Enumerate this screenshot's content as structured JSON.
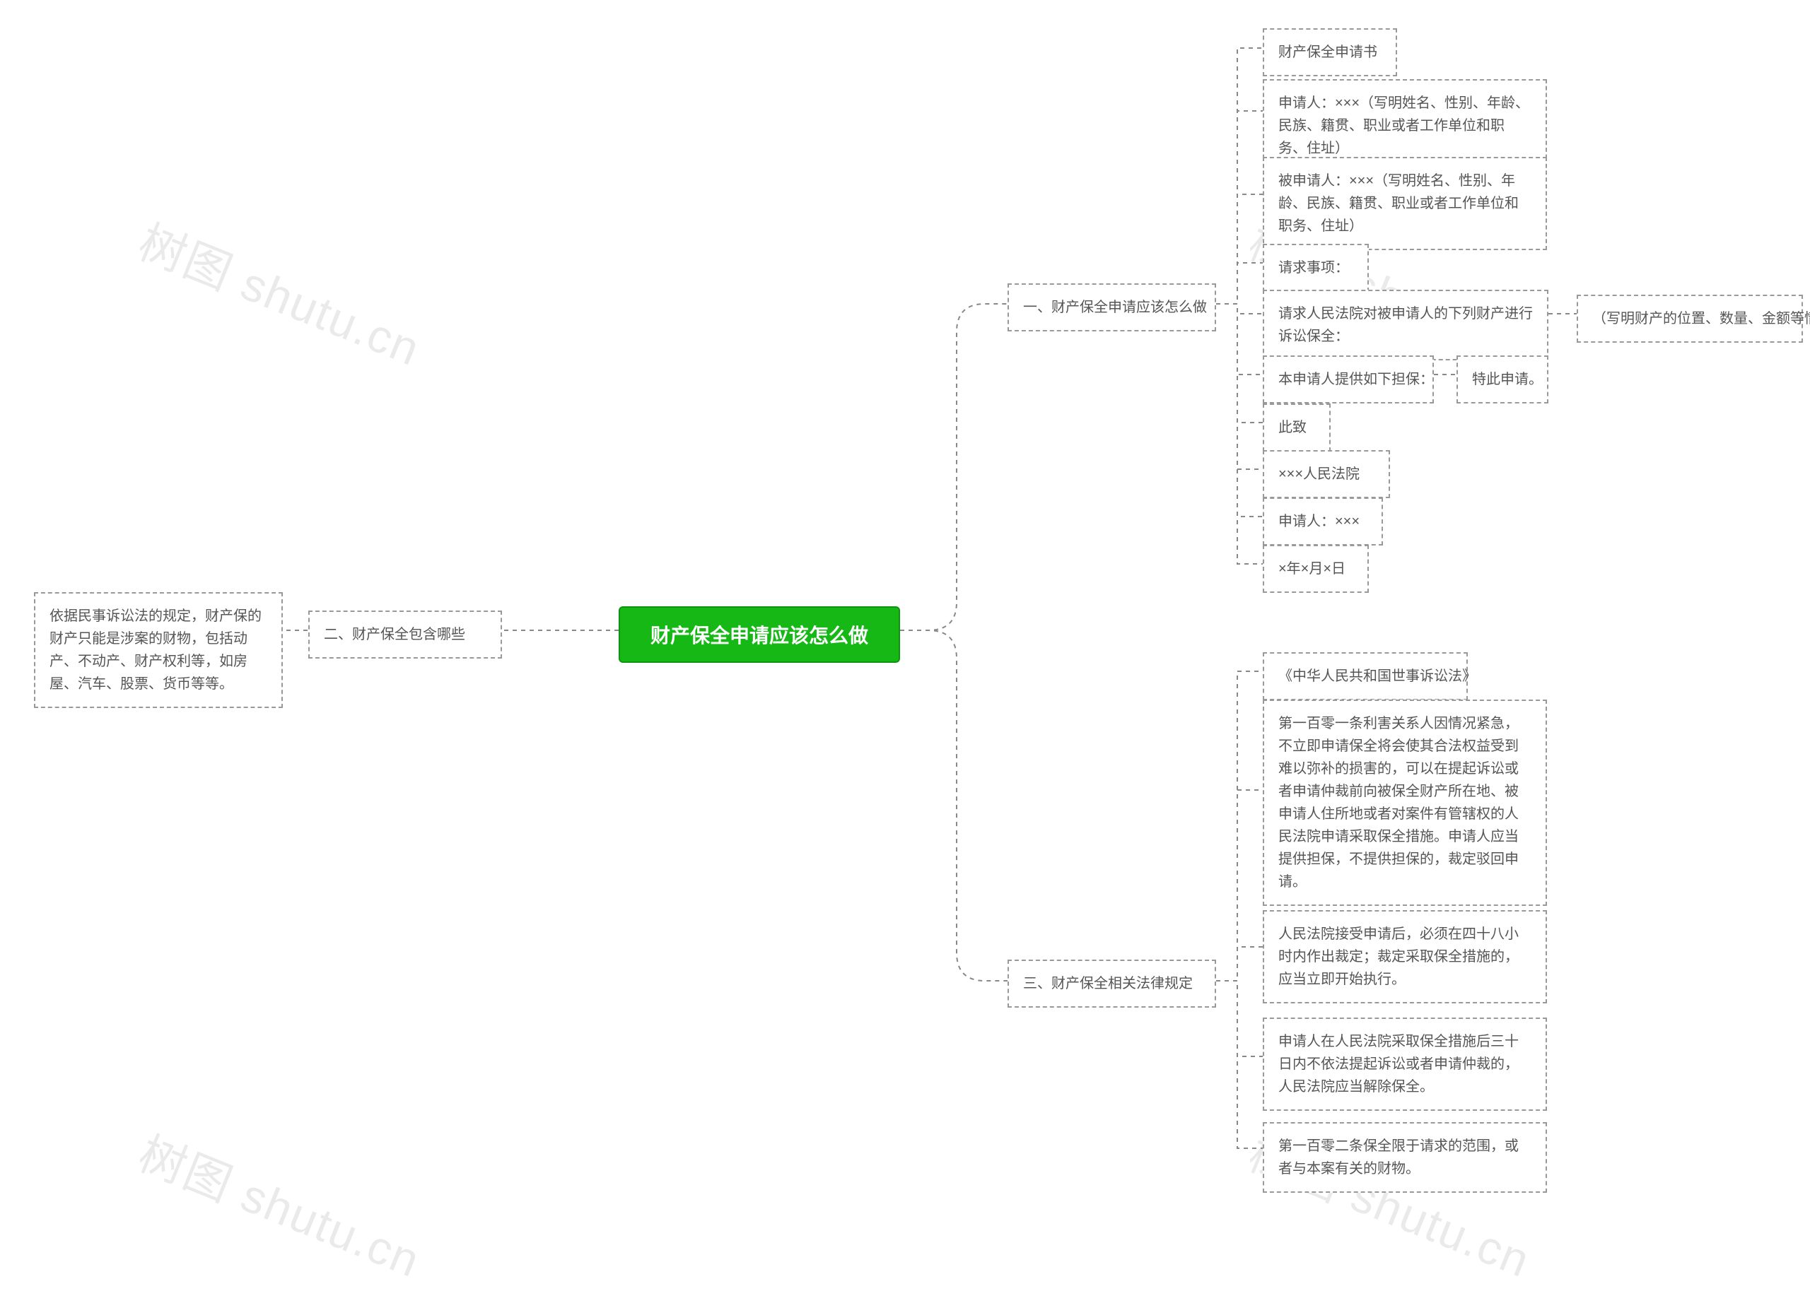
{
  "watermarks": [
    "树图 shutu.cn",
    "树图 shutu.cn",
    "树图 shutu.cn",
    "树图 shutu.cn"
  ],
  "root": {
    "title": "财产保全申请应该怎么做"
  },
  "branch1": {
    "label": "一、财产保全申请应该怎么做",
    "items": [
      "财产保全申请书",
      "申请人：×××（写明姓名、性别、年龄、民族、籍贯、职业或者工作单位和职务、住址）",
      "被申请人：×××（写明姓名、性别、年龄、民族、籍贯、职业或者工作单位和职务、住址）",
      "请求事项：",
      "请求人民法院对被申请人的下列财产进行诉讼保全：",
      "本申请人提供如下担保：",
      "此致",
      "×××人民法院",
      "申请人：×××",
      "×年×月×日"
    ],
    "item4_extra": "（写明财产的位置、数量、金额等情况）",
    "item5_extra": "特此申请。"
  },
  "branch2": {
    "label": "二、财产保全包含哪些",
    "detail": "依据民事诉讼法的规定，财产保的财产只能是涉案的财物，包括动产、不动产、财产权利等，如房屋、汽车、股票、货币等等。"
  },
  "branch3": {
    "label": "三、财产保全相关法律规定",
    "items": [
      "《中华人民共和国世事诉讼法》",
      "第一百零一条利害关系人因情况紧急，不立即申请保全将会使其合法权益受到难以弥补的损害的，可以在提起诉讼或者申请仲裁前向被保全财产所在地、被申请人住所地或者对案件有管辖权的人民法院申请采取保全措施。申请人应当提供担保，不提供担保的，裁定驳回申请。",
      "人民法院接受申请后，必须在四十八小时内作出裁定；裁定采取保全措施的，应当立即开始执行。",
      "申请人在人民法院采取保全措施后三十日内不依法提起诉讼或者申请仲裁的，人民法院应当解除保全。",
      "第一百零二条保全限于请求的范围，或者与本案有关的财物。"
    ]
  }
}
